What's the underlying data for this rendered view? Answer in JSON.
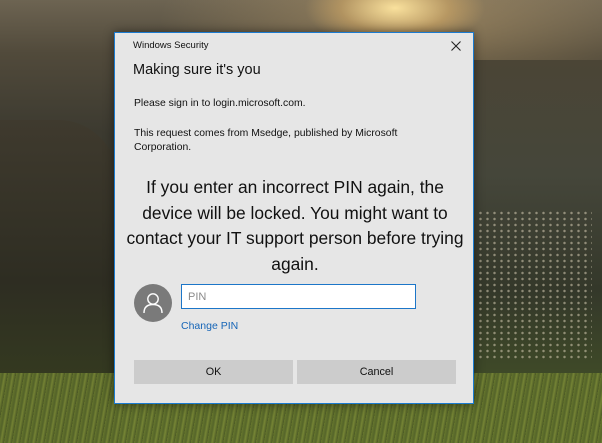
{
  "dialog": {
    "window_title": "Windows Security",
    "heading": "Making sure it's you",
    "signin_text": "Please sign in to login.microsoft.com.",
    "request_text": "This request comes from Msedge, published by Microsoft Corporation.",
    "warning_text": "If you enter an incorrect PIN again, the device will be locked. You might want to contact your IT support person before trying again.",
    "pin_placeholder": "PIN",
    "pin_value": "",
    "change_pin_label": "Change PIN",
    "ok_label": "OK",
    "cancel_label": "Cancel"
  },
  "icons": {
    "close": "close-icon",
    "avatar": "user-avatar-icon"
  },
  "colors": {
    "dialog_background": "#e6e6e6",
    "accent_border": "#1b7bd0",
    "link": "#1665b7",
    "button_background": "#cccccc",
    "avatar_background": "#7a7a7a"
  }
}
